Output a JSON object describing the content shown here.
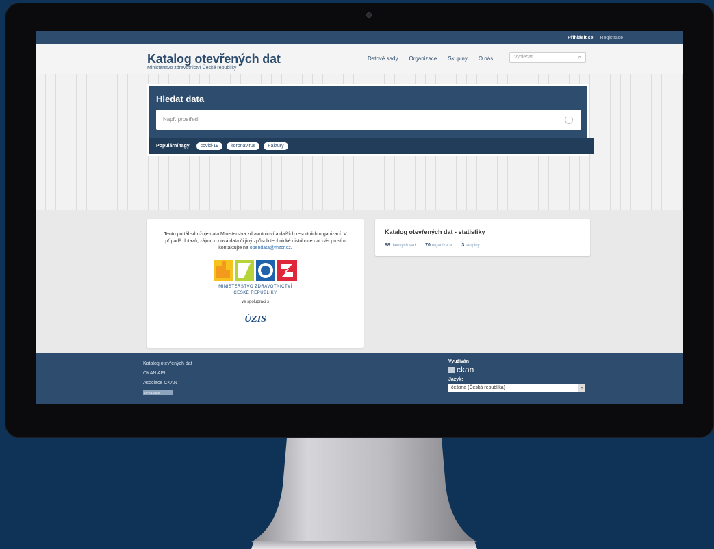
{
  "topbar": {
    "login": "Přihlásit se",
    "register": "Registrace"
  },
  "header": {
    "title": "Katalog otevřených dat",
    "subtitle": "Ministerstvo zdravotnictví České republiky",
    "nav": [
      "Datové sady",
      "Organizace",
      "Skupiny",
      "O nás"
    ],
    "search_placeholder": "Vyhledat"
  },
  "hero": {
    "heading": "Hledat data",
    "input_placeholder": "Např. prostředí",
    "tags_label": "Populární tagy",
    "tags": [
      "covid-19",
      "koronavirus",
      "Faktury"
    ]
  },
  "about": {
    "text": "Tento portál sdružuje data Ministerstva zdravotnictví a dalších resortních organizací. V případě dotazů, zájmu o nová data či jiný způsob technické distribuce dat nás prosím kontaktujte na ",
    "email": "opendata@mzcr.cz",
    "after_email": ".",
    "ministry_line1": "MINISTERSTVO ZDRAVOTNICTVÍ",
    "ministry_line2": "ČESKÉ REPUBLIKY",
    "coop": "ve spolupráci s",
    "partner": "ÚZIS"
  },
  "stats": {
    "title": "Katalog otevřených dat - statistiky",
    "items": [
      {
        "count": "88",
        "label": "datových sad"
      },
      {
        "count": "70",
        "label": "organizace"
      },
      {
        "count": "3",
        "label": "skupiny"
      }
    ]
  },
  "footer": {
    "links": [
      "Katalog otevřených dat",
      "CKAN API",
      "Asociace CKAN"
    ],
    "badge": "OPEN DATA",
    "powered_label": "Využíván",
    "powered_name": "ckan",
    "lang_label": "Jazyk:",
    "lang_value": "čeština (Česká republika)"
  },
  "colors": {
    "primary": "#2d4c6e",
    "background": "#0f3356"
  }
}
